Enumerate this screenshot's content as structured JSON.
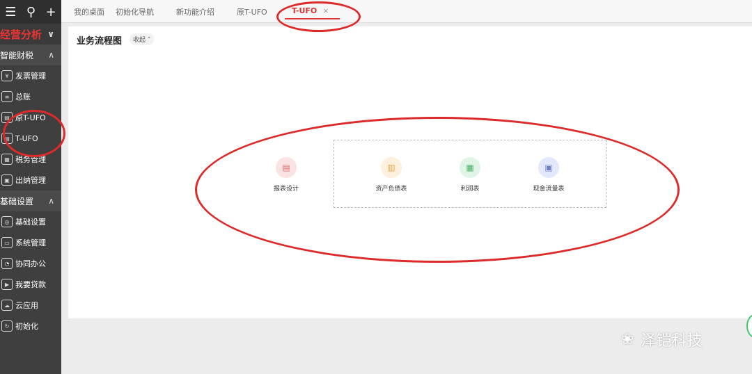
{
  "sidebar": {
    "sections": [
      {
        "title": "经营分析",
        "color": "#e33333",
        "chevron": "∨"
      },
      {
        "title": "智能财税",
        "chevron": "∧",
        "items": [
          "发票管理",
          "总账",
          "原T-UFO",
          "T-UFO",
          "税务管理",
          "出纳管理"
        ]
      },
      {
        "title": "基础设置",
        "chevron": "∧",
        "items": [
          "基础设置",
          "系统管理",
          "协同办公",
          "我要贷款",
          "云应用",
          "初始化"
        ]
      }
    ]
  },
  "tabs": [
    {
      "label": "我的桌面"
    },
    {
      "label": "初始化导航"
    },
    {
      "label": "新功能介绍"
    },
    {
      "label": "原T-UFO"
    },
    {
      "label": "T-UFO",
      "active": true,
      "close": "×"
    }
  ],
  "panel": {
    "title": "业务流程图",
    "collapse": "收起 ˄",
    "funcs": [
      {
        "label": "报表设计",
        "color": "#fbe3e3",
        "icon_color": "#e07070"
      },
      {
        "label": "资产负债表",
        "color": "#fdf0dc",
        "icon_color": "#e6a64b"
      },
      {
        "label": "利润表",
        "color": "#e0f5e6",
        "icon_color": "#4fb36c"
      },
      {
        "label": "现金流量表",
        "color": "#e3e8fb",
        "icon_color": "#6b7fd0"
      }
    ]
  },
  "watermark": {
    "text": "泽铠科技"
  },
  "accent_red": "#dd2a2a"
}
